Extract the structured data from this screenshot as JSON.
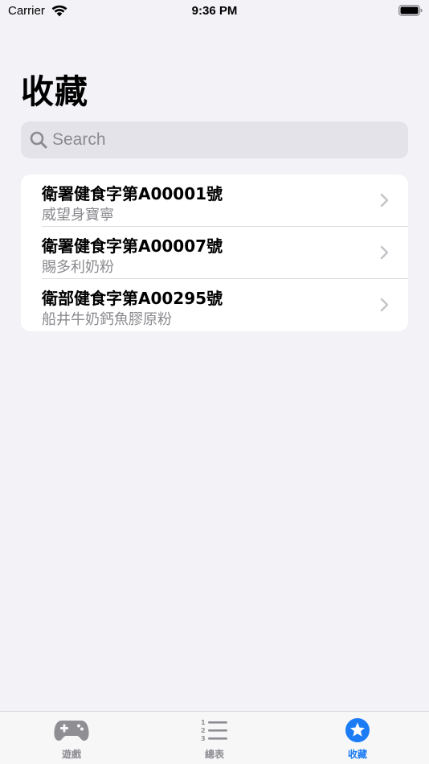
{
  "status_bar": {
    "carrier": "Carrier",
    "time": "9:36 PM"
  },
  "header": {
    "title": "收藏"
  },
  "search": {
    "placeholder": "Search",
    "value": ""
  },
  "list": {
    "items": [
      {
        "title": "衛署健食字第A00001號",
        "subtitle": "威望身寶寧"
      },
      {
        "title": "衛署健食字第A00007號",
        "subtitle": "賜多利奶粉"
      },
      {
        "title": "衛部健食字第A00295號",
        "subtitle": "船井牛奶鈣魚膠原粉"
      }
    ]
  },
  "tab_bar": {
    "tabs": [
      {
        "label": "遊戲",
        "icon": "gamecontroller-icon",
        "active": false
      },
      {
        "label": "總表",
        "icon": "numbered-list-icon",
        "active": false
      },
      {
        "label": "收藏",
        "icon": "star-circle-icon",
        "active": true
      }
    ]
  },
  "colors": {
    "background": "#f2f2f7",
    "accent": "#1b7cf5",
    "inactive": "#8e8e93",
    "secondary_text": "#8a8a8f"
  }
}
